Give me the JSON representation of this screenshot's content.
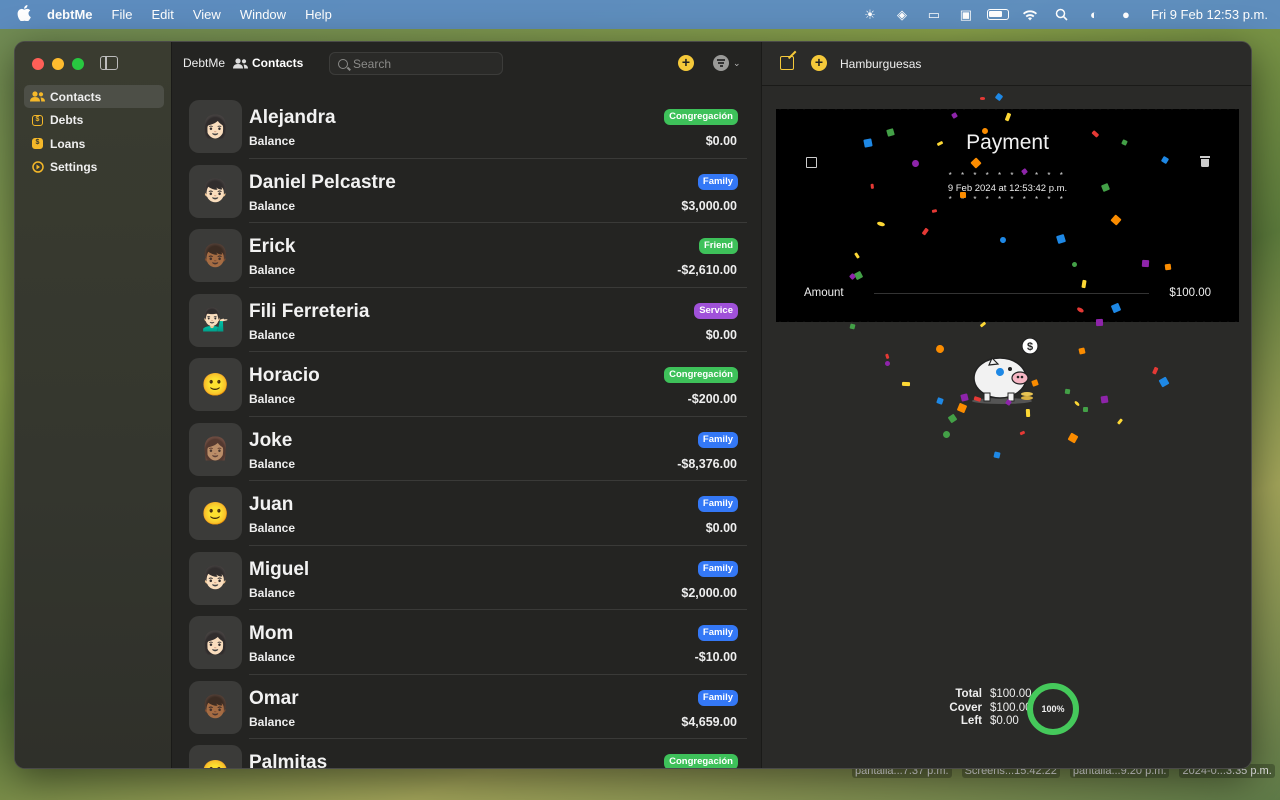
{
  "menubar": {
    "app_name": "debtMe",
    "menus": [
      "File",
      "Edit",
      "View",
      "Window",
      "Help"
    ],
    "clock": "Fri 9 Feb  12:53 p.m."
  },
  "desktop_files": [
    "pantalla...7.37 p.m.",
    "Screens...15.42.22",
    "pantalla...9.20 p.m.",
    "2024-0...3.35 p.m."
  ],
  "sidebar": {
    "items": [
      {
        "label": "Contacts",
        "icon": "contacts-icon",
        "active": true
      },
      {
        "label": "Debts",
        "icon": "debts-icon",
        "active": false
      },
      {
        "label": "Loans",
        "icon": "loans-icon",
        "active": false
      },
      {
        "label": "Settings",
        "icon": "settings-icon",
        "active": false
      }
    ]
  },
  "list_toolbar": {
    "breadcrumb": "DebtMe",
    "section": "Contacts",
    "search_placeholder": "Search"
  },
  "badge_colors": {
    "Congregación": "#3ec15a",
    "Family": "#3478f6",
    "Friend": "#3ec15a",
    "Service": "#a051d9"
  },
  "contacts": [
    {
      "name": "Alejandra",
      "balance_label": "Balance",
      "tag": "Congregación",
      "amount": "$0.00",
      "avatar": "👩🏻"
    },
    {
      "name": "Daniel Pelcastre",
      "balance_label": "Balance",
      "tag": "Family",
      "amount": "$3,000.00",
      "avatar": "👦🏻"
    },
    {
      "name": "Erick",
      "balance_label": "Balance",
      "tag": "Friend",
      "amount": "-$2,610.00",
      "avatar": "👦🏾"
    },
    {
      "name": "Fili Ferreteria",
      "balance_label": "Balance",
      "tag": "Service",
      "amount": "$0.00",
      "avatar": "💁🏻‍♂️"
    },
    {
      "name": "Horacio",
      "balance_label": "Balance",
      "tag": "Congregación",
      "amount": "-$200.00",
      "avatar": "🙂"
    },
    {
      "name": "Joke",
      "balance_label": "Balance",
      "tag": "Family",
      "amount": "-$8,376.00",
      "avatar": "👩🏽"
    },
    {
      "name": "Juan",
      "balance_label": "Balance",
      "tag": "Family",
      "amount": "$0.00",
      "avatar": "🙂"
    },
    {
      "name": "Miguel",
      "balance_label": "Balance",
      "tag": "Family",
      "amount": "$2,000.00",
      "avatar": "👦🏻"
    },
    {
      "name": "Mom",
      "balance_label": "Balance",
      "tag": "Family",
      "amount": "-$10.00",
      "avatar": "👩🏻"
    },
    {
      "name": "Omar",
      "balance_label": "Balance",
      "tag": "Family",
      "amount": "$4,659.00",
      "avatar": "👦🏾"
    },
    {
      "name": "Palmitas",
      "balance_label": "Balance",
      "tag": "Congregación",
      "amount": "",
      "avatar": "🙂"
    }
  ],
  "detail": {
    "title": "Hamburguesas",
    "ticket": {
      "title": "Payment",
      "date": "9 Feb 2024 at 12:53:42 p.m.",
      "stars": "* * * * * * * * * *",
      "amount_label": "Amount",
      "amount_value": "$100.00"
    },
    "summary": [
      {
        "label": "Total",
        "value": "$100.00"
      },
      {
        "label": "Cover",
        "value": "$100.00"
      },
      {
        "label": "Left",
        "value": "$0.00"
      }
    ],
    "progress_text": "100%",
    "progress_fraction": 1.0,
    "progress_color": "#45c95b"
  }
}
